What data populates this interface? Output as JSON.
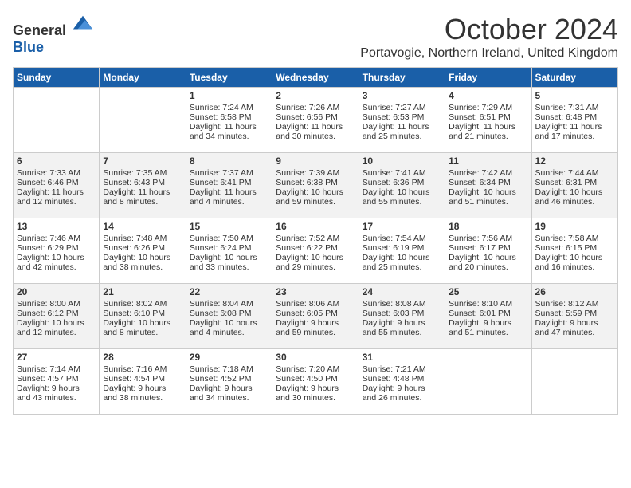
{
  "logo": {
    "general": "General",
    "blue": "Blue"
  },
  "header": {
    "month": "October 2024",
    "location": "Portavogie, Northern Ireland, United Kingdom"
  },
  "weekdays": [
    "Sunday",
    "Monday",
    "Tuesday",
    "Wednesday",
    "Thursday",
    "Friday",
    "Saturday"
  ],
  "weeks": [
    [
      {
        "day": "",
        "data": ""
      },
      {
        "day": "",
        "data": ""
      },
      {
        "day": "1",
        "data": "Sunrise: 7:24 AM\nSunset: 6:58 PM\nDaylight: 11 hours\nand 34 minutes."
      },
      {
        "day": "2",
        "data": "Sunrise: 7:26 AM\nSunset: 6:56 PM\nDaylight: 11 hours\nand 30 minutes."
      },
      {
        "day": "3",
        "data": "Sunrise: 7:27 AM\nSunset: 6:53 PM\nDaylight: 11 hours\nand 25 minutes."
      },
      {
        "day": "4",
        "data": "Sunrise: 7:29 AM\nSunset: 6:51 PM\nDaylight: 11 hours\nand 21 minutes."
      },
      {
        "day": "5",
        "data": "Sunrise: 7:31 AM\nSunset: 6:48 PM\nDaylight: 11 hours\nand 17 minutes."
      }
    ],
    [
      {
        "day": "6",
        "data": "Sunrise: 7:33 AM\nSunset: 6:46 PM\nDaylight: 11 hours\nand 12 minutes."
      },
      {
        "day": "7",
        "data": "Sunrise: 7:35 AM\nSunset: 6:43 PM\nDaylight: 11 hours\nand 8 minutes."
      },
      {
        "day": "8",
        "data": "Sunrise: 7:37 AM\nSunset: 6:41 PM\nDaylight: 11 hours\nand 4 minutes."
      },
      {
        "day": "9",
        "data": "Sunrise: 7:39 AM\nSunset: 6:38 PM\nDaylight: 10 hours\nand 59 minutes."
      },
      {
        "day": "10",
        "data": "Sunrise: 7:41 AM\nSunset: 6:36 PM\nDaylight: 10 hours\nand 55 minutes."
      },
      {
        "day": "11",
        "data": "Sunrise: 7:42 AM\nSunset: 6:34 PM\nDaylight: 10 hours\nand 51 minutes."
      },
      {
        "day": "12",
        "data": "Sunrise: 7:44 AM\nSunset: 6:31 PM\nDaylight: 10 hours\nand 46 minutes."
      }
    ],
    [
      {
        "day": "13",
        "data": "Sunrise: 7:46 AM\nSunset: 6:29 PM\nDaylight: 10 hours\nand 42 minutes."
      },
      {
        "day": "14",
        "data": "Sunrise: 7:48 AM\nSunset: 6:26 PM\nDaylight: 10 hours\nand 38 minutes."
      },
      {
        "day": "15",
        "data": "Sunrise: 7:50 AM\nSunset: 6:24 PM\nDaylight: 10 hours\nand 33 minutes."
      },
      {
        "day": "16",
        "data": "Sunrise: 7:52 AM\nSunset: 6:22 PM\nDaylight: 10 hours\nand 29 minutes."
      },
      {
        "day": "17",
        "data": "Sunrise: 7:54 AM\nSunset: 6:19 PM\nDaylight: 10 hours\nand 25 minutes."
      },
      {
        "day": "18",
        "data": "Sunrise: 7:56 AM\nSunset: 6:17 PM\nDaylight: 10 hours\nand 20 minutes."
      },
      {
        "day": "19",
        "data": "Sunrise: 7:58 AM\nSunset: 6:15 PM\nDaylight: 10 hours\nand 16 minutes."
      }
    ],
    [
      {
        "day": "20",
        "data": "Sunrise: 8:00 AM\nSunset: 6:12 PM\nDaylight: 10 hours\nand 12 minutes."
      },
      {
        "day": "21",
        "data": "Sunrise: 8:02 AM\nSunset: 6:10 PM\nDaylight: 10 hours\nand 8 minutes."
      },
      {
        "day": "22",
        "data": "Sunrise: 8:04 AM\nSunset: 6:08 PM\nDaylight: 10 hours\nand 4 minutes."
      },
      {
        "day": "23",
        "data": "Sunrise: 8:06 AM\nSunset: 6:05 PM\nDaylight: 9 hours\nand 59 minutes."
      },
      {
        "day": "24",
        "data": "Sunrise: 8:08 AM\nSunset: 6:03 PM\nDaylight: 9 hours\nand 55 minutes."
      },
      {
        "day": "25",
        "data": "Sunrise: 8:10 AM\nSunset: 6:01 PM\nDaylight: 9 hours\nand 51 minutes."
      },
      {
        "day": "26",
        "data": "Sunrise: 8:12 AM\nSunset: 5:59 PM\nDaylight: 9 hours\nand 47 minutes."
      }
    ],
    [
      {
        "day": "27",
        "data": "Sunrise: 7:14 AM\nSunset: 4:57 PM\nDaylight: 9 hours\nand 43 minutes."
      },
      {
        "day": "28",
        "data": "Sunrise: 7:16 AM\nSunset: 4:54 PM\nDaylight: 9 hours\nand 38 minutes."
      },
      {
        "day": "29",
        "data": "Sunrise: 7:18 AM\nSunset: 4:52 PM\nDaylight: 9 hours\nand 34 minutes."
      },
      {
        "day": "30",
        "data": "Sunrise: 7:20 AM\nSunset: 4:50 PM\nDaylight: 9 hours\nand 30 minutes."
      },
      {
        "day": "31",
        "data": "Sunrise: 7:21 AM\nSunset: 4:48 PM\nDaylight: 9 hours\nand 26 minutes."
      },
      {
        "day": "",
        "data": ""
      },
      {
        "day": "",
        "data": ""
      }
    ]
  ]
}
